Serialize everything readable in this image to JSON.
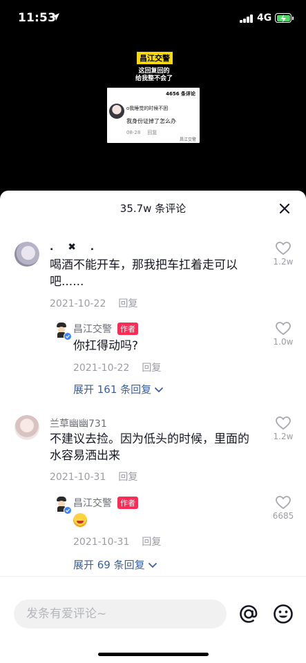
{
  "status_bar": {
    "time": "11:53",
    "network": "4G",
    "battery": "charging"
  },
  "video": {
    "badge": "昌江交警",
    "caption_line1": "这回复回的",
    "caption_line2": "给我整不会了",
    "card_count": "4656 条评论",
    "card_line1": "o我睡觉的时候不困",
    "card_line2": "我身份证掉了怎么办",
    "card_date": "08-28",
    "card_reply": "回复",
    "card_brand": "昌江交警"
  },
  "sheet": {
    "title": "35.7w 条评论",
    "close_icon": "close-icon"
  },
  "comments": [
    {
      "user": ". ✖ .",
      "text_line1": "喝酒不能开车，那我把车扛着走可以",
      "text_line2": "吧......",
      "date": "2021-10-22",
      "reply_label": "回复",
      "likes": "1.2w",
      "reply": {
        "user": "昌江交警",
        "author_tag": "作者",
        "text": "你扛得动吗?",
        "date": "2021-10-22",
        "reply_label": "回复",
        "likes": "1.0w"
      },
      "expand_label": "展开 161 条回复"
    },
    {
      "user": "兰草幽幽731",
      "text_line1": "不建议去捡。因为低头的时候，里面的",
      "text_line2": "水容易洒出来",
      "date": "2021-10-31",
      "reply_label": "回复",
      "likes": "1.2w",
      "reply": {
        "user": "昌江交警",
        "author_tag": "作者",
        "date": "2021-10-31",
        "reply_label": "回复",
        "likes": "6685"
      },
      "expand_label": "展开 69 条回复"
    }
  ],
  "input_bar": {
    "placeholder": "发条有爱评论~",
    "at_icon": "at-icon",
    "emoji_icon": "emoji-icon"
  }
}
